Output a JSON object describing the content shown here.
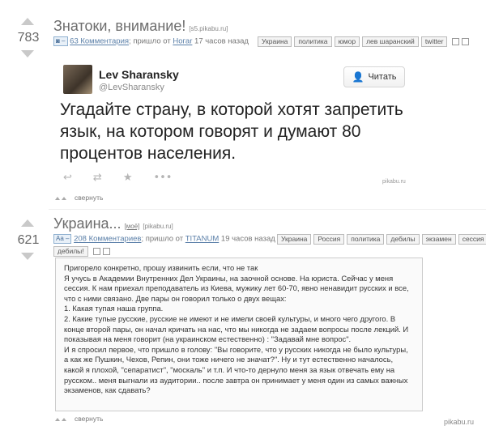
{
  "post1": {
    "rating": "783",
    "title": "Знатоки, внимание!",
    "source": "[s5.pikabu.ru]",
    "badge": "◙ –",
    "comments_link": "63 Комментария",
    "meta_mid": "; пришло от",
    "author": "Нoгar",
    "time": "17 часов назад",
    "tags": [
      "Украина",
      "политика",
      "юмор",
      "лев шаранский",
      "twitter"
    ],
    "tweet": {
      "name": "Lev Sharansky",
      "handle": "@LevSharansky",
      "follow_label": "Читать",
      "text": "Угадайте страну, в которой хотят запретить язык, на котором говорят и думают 80 процентов населения.",
      "actions": [
        "reply-icon",
        "retweet-icon",
        "star-icon",
        "more-icon"
      ],
      "action_glyphs": [
        "↩",
        "⇄",
        "★",
        "•••"
      ]
    },
    "watermark": "pikabu.ru",
    "collapse_label": "свернуть"
  },
  "post2": {
    "rating": "621",
    "title": "Украина...",
    "mine_link": "[моё]",
    "source": "[pikabu.ru]",
    "badge": "Aa –",
    "comments_link": "208 Комментариев",
    "meta_mid": "; пришло от",
    "author": "TITANUM",
    "time": "19 часов назад",
    "tags": [
      "Украина",
      "Россия",
      "политика",
      "дебилы",
      "экзамен",
      "сессия",
      "дебилы!"
    ],
    "body": [
      "Пригорело конкретно, прошу извинить если, что не так",
      "Я учусь в Академии Внутренних Дел Украины, на заочной основе. На юриста. Сейчас у меня сессия. К нам приехал преподаватель из Киева, мужику лет 60-70, явно ненавидит русских и все, что с ними связано. Две пары он говорил только о двух вещах:",
      "1. Какая тупая наша группа.",
      "2. Какие тупые русские, русские не имеют и не имели своей культуры, и много чего другого. В конце второй пары, он начал кричать на нас, что мы никогда не задаем вопросы после лекций. И показывая на меня говорит (на украинском естественно) : \"Задавай мне вопрос\".",
      "И я спросил первое, что пришло в голову: \"Вы говорите, что у русских никогда не было культуры, а как же Пушкин, Чехов, Репин, они тоже ничего не значат?\". Ну и тут естественно началось, какой я плохой, \"сепаратист\", \"москаль\" и т.п. И что-то дернуло меня за язык отвечать ему на русском.. меня выгнали из аудитории.. после завтра он принимает у меня один из самых важных экзаменов, как сдавать?"
    ],
    "collapse_label": "свернуть",
    "watermark": "pikabu.ru"
  }
}
